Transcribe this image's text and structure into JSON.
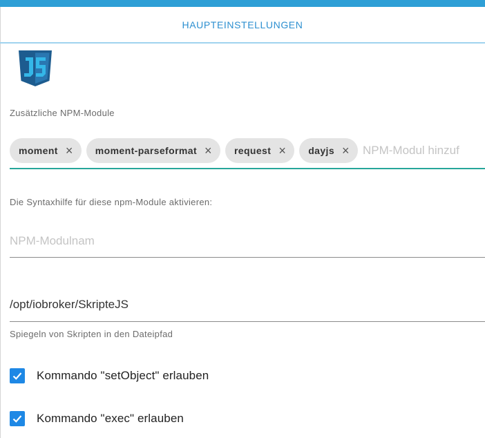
{
  "tab": {
    "title": "HAUPTEINSTELLUNGEN"
  },
  "logo": {
    "icon": "javascript-shield-icon"
  },
  "npm_modules": {
    "label": "Zusätzliche NPM-Module",
    "chips": [
      {
        "label": "moment"
      },
      {
        "label": "moment-parseformat"
      },
      {
        "label": "request"
      },
      {
        "label": "dayjs"
      }
    ],
    "chip_remove_icon": "×",
    "input_placeholder": "NPM-Modul hinzufügen"
  },
  "syntax_help": {
    "label": "Die Syntaxhilfe für diese npm-Module aktivieren:",
    "placeholder": "NPM-Modulnam"
  },
  "mirror_path": {
    "value": "/opt/iobroker/SkripteJS",
    "helper": "Spiegeln von Skripten in den Dateipfad"
  },
  "checkboxes": [
    {
      "label": "Kommando \"setObject\" erlauben",
      "checked": true
    },
    {
      "label": "Kommando \"exec\" erlauben",
      "checked": true
    }
  ],
  "colors": {
    "accent_bar": "#2e9fd6",
    "tab_text": "#2c8fd0",
    "chip_underline": "#26a69a",
    "checkbox": "#1e88e5"
  }
}
